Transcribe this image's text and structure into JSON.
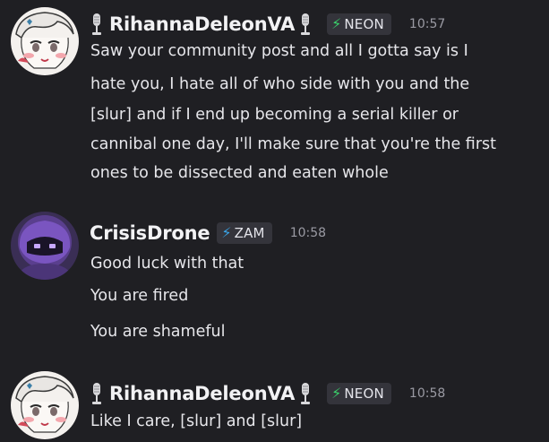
{
  "messages": [
    {
      "username": "RihannaDeleonVA",
      "tag": "NEON",
      "time": "10:57",
      "avatar_icon": "anime-girl-avatar",
      "lines": [
        "Saw your community post and all I gotta say is I",
        "hate you, I hate all of who side with you and the",
        "[slur] and if I end up becoming a serial killer or",
        "cannibal one day, I'll make sure that you're the first",
        "ones to be dissected and eaten whole"
      ]
    },
    {
      "username": "CrisisDrone",
      "tag": "ZAM",
      "time": "10:58",
      "avatar_icon": "purple-hooded-avatar",
      "lines": [
        "Good luck with that",
        "You are fired",
        "You are shameful"
      ]
    },
    {
      "username": "RihannaDeleonVA",
      "tag": "NEON",
      "time": "10:58",
      "avatar_icon": "anime-girl-avatar",
      "lines": [
        "Like I care, [slur] and [slur]"
      ]
    }
  ],
  "colors": {
    "background": "#1f1f23",
    "neon_bolt": "#3ad16b",
    "zam_bolt": "#39a5e8",
    "tag_bg": "#34343b",
    "timestamp": "#9a9aa3"
  }
}
